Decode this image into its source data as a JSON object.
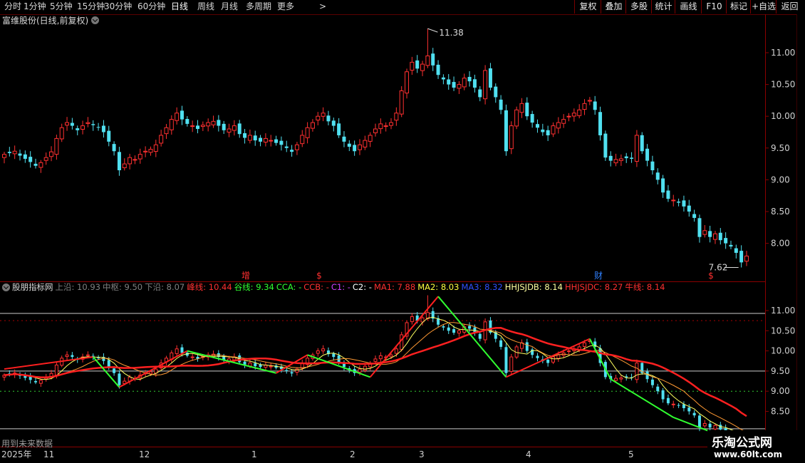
{
  "toolbar": {
    "periods": [
      "分时",
      "1分钟",
      "5分钟",
      "15分钟",
      "30分钟",
      "60分钟",
      "日线",
      "周线",
      "月线",
      "多周期",
      "更多"
    ],
    "active_period": "日线",
    "more_arrow": "chevron-right-icon",
    "buttons": [
      "复权",
      "叠加",
      "多股",
      "统计",
      "画线",
      "F10",
      "标记",
      "+自选",
      "返回"
    ]
  },
  "main_panel": {
    "title": "富维股份(日线,前复权)",
    "high_label": "11.38",
    "low_label": "7.62",
    "y_labels": [
      "11.00",
      "10.50",
      "10.00",
      "9.50",
      "9.00",
      "8.50",
      "8.00"
    ],
    "markers": [
      {
        "text": "增",
        "color": "#ff3030"
      },
      {
        "text": "$",
        "color": "#ff3030"
      },
      {
        "text": "财",
        "color": "#3080ff"
      },
      {
        "text": "$",
        "color": "#ff3030"
      }
    ]
  },
  "indicator_panel": {
    "title": "股朋指标网",
    "items": [
      {
        "label": "上沿:",
        "value": "10.93",
        "color": "#808080"
      },
      {
        "label": "中枢:",
        "value": "9.50",
        "color": "#808080"
      },
      {
        "label": "下沿:",
        "value": "8.07",
        "color": "#808080"
      },
      {
        "label": "峰线:",
        "value": "10.44",
        "color": "#ff3030"
      },
      {
        "label": "谷线:",
        "value": "9.34",
        "color": "#30ff30"
      },
      {
        "label": "CCA:",
        "value": "-",
        "color": "#30ff30"
      },
      {
        "label": "CCB:",
        "value": "-",
        "color": "#ff3030"
      },
      {
        "label": "C1:",
        "value": "-",
        "color": "#d040ff"
      },
      {
        "label": "C2:",
        "value": "-",
        "color": "#ffffff"
      },
      {
        "label": "MA1:",
        "value": "7.88",
        "color": "#ff3030"
      },
      {
        "label": "MA2:",
        "value": "8.03",
        "color": "#ffff40"
      },
      {
        "label": "MA3:",
        "value": "8.32",
        "color": "#3050ff"
      },
      {
        "label": "HHJSJDB:",
        "value": "8.14",
        "color": "#ffffa0"
      },
      {
        "label": "HHJSJDC:",
        "value": "8.27",
        "color": "#ff3030"
      },
      {
        "label": "牛线:",
        "value": "8.14",
        "color": "#ff3030"
      }
    ],
    "y_labels": [
      "11.00",
      "10.50",
      "10.00",
      "9.50",
      "9.00",
      "8.50"
    ],
    "note": "用到未来数据"
  },
  "x_axis": {
    "labels": [
      "2025年",
      "11",
      "12",
      "1",
      "2",
      "3",
      "4",
      "5"
    ]
  },
  "watermark": {
    "line1": "乐淘公式网",
    "line2": "www.60lt.com"
  },
  "colors": {
    "up": "#ff3030",
    "down": "#50e0f0",
    "axis_red": "#8b0000"
  },
  "chart_data": {
    "type": "candlestick",
    "title": "富维股份(日线,前复权)",
    "ylim": [
      7.55,
      11.55
    ],
    "y_ticks": [
      11.0,
      10.5,
      10.0,
      9.5,
      9.0,
      8.5,
      8.0
    ],
    "series": [
      {
        "name": "price",
        "close": [
          9.4,
          9.42,
          9.45,
          9.38,
          9.33,
          9.28,
          9.22,
          9.27,
          9.35,
          9.44,
          9.65,
          9.82,
          9.9,
          9.85,
          9.78,
          9.85,
          9.9,
          9.86,
          9.82,
          9.75,
          9.6,
          9.45,
          9.15,
          9.25,
          9.35,
          9.32,
          9.4,
          9.45,
          9.48,
          9.55,
          9.7,
          9.82,
          9.95,
          10.05,
          9.95,
          9.88,
          9.85,
          9.8,
          9.86,
          9.9,
          9.92,
          9.85,
          9.78,
          9.8,
          9.85,
          9.72,
          9.66,
          9.7,
          9.62,
          9.6,
          9.65,
          9.62,
          9.58,
          9.55,
          9.5,
          9.44,
          9.55,
          9.7,
          9.82,
          9.9,
          10.0,
          10.05,
          9.92,
          9.85,
          9.7,
          9.6,
          9.52,
          9.45,
          9.55,
          9.62,
          9.7,
          9.8,
          9.88,
          9.85,
          9.9,
          10.05,
          10.4,
          10.7,
          10.85,
          10.75,
          10.82,
          10.95,
          10.8,
          10.65,
          10.58,
          10.5,
          10.45,
          10.5,
          10.6,
          10.55,
          10.45,
          10.3,
          10.72,
          10.45,
          10.3,
          10.1,
          9.45,
          9.85,
          10.1,
          10.2,
          10.0,
          9.9,
          9.82,
          9.75,
          9.7,
          9.85,
          9.9,
          9.95,
          10.0,
          10.05,
          10.1,
          10.2,
          10.25,
          10.1,
          9.7,
          9.35,
          9.3,
          9.32,
          9.33,
          9.34,
          9.33,
          9.7,
          9.45,
          9.3,
          9.15,
          9.0,
          8.8,
          8.7,
          8.68,
          8.64,
          8.58,
          8.5,
          8.4,
          8.1,
          8.2,
          8.1,
          8.15,
          8.05,
          8.0,
          7.95,
          7.85,
          7.7,
          7.8
        ]
      }
    ],
    "annotations": [
      {
        "text": "11.38",
        "type": "high"
      },
      {
        "text": "7.62",
        "type": "low"
      }
    ]
  }
}
